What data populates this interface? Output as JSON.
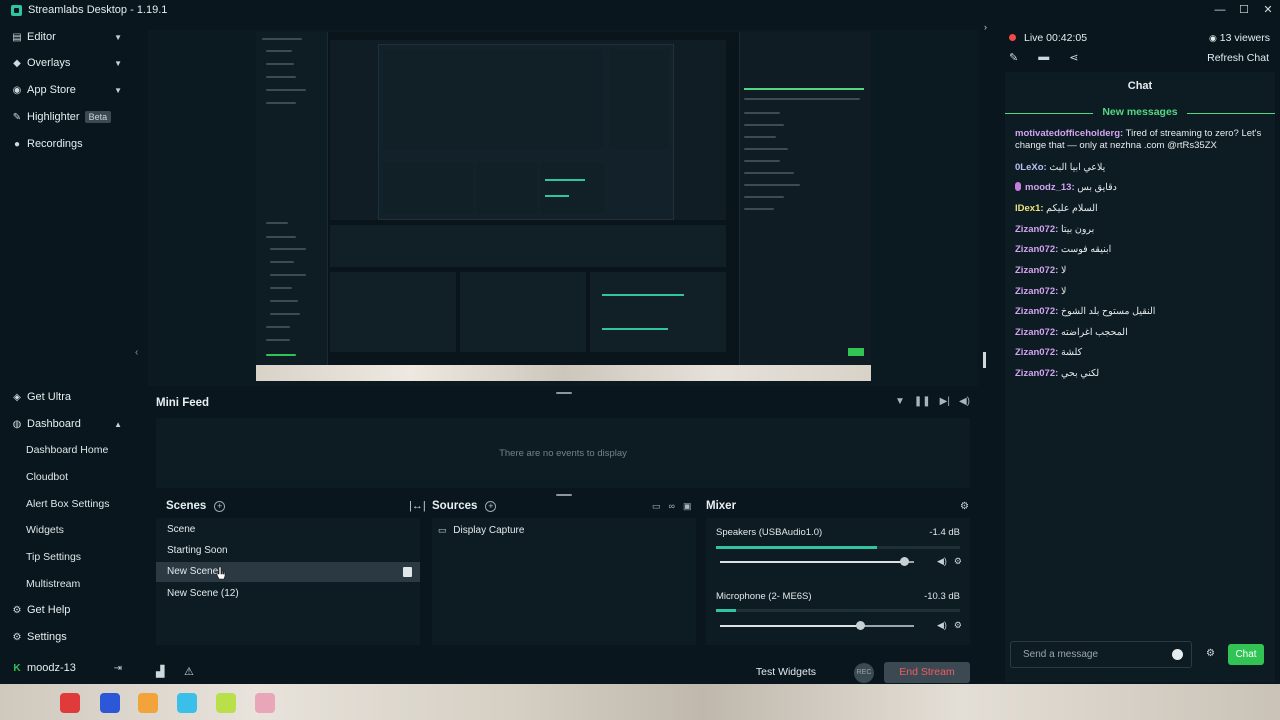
{
  "app": {
    "title": "Streamlabs Desktop - 1.19.1"
  },
  "window_controls": {
    "minimize": "—",
    "maximize": "☐",
    "close": "✕"
  },
  "sidebar": {
    "top_items": [
      {
        "label": "Editor",
        "icon": "editor-icon"
      },
      {
        "label": "Overlays",
        "icon": "overlays-icon"
      },
      {
        "label": "App Store",
        "icon": "appstore-icon"
      },
      {
        "label": "Highlighter",
        "icon": "highlighter-icon",
        "badge": "Beta"
      },
      {
        "label": "Recordings",
        "icon": "recordings-icon"
      }
    ],
    "get_ultra": "Get Ultra",
    "dashboard": "Dashboard",
    "dashboard_items": [
      "Dashboard Home",
      "Cloudbot",
      "Alert Box Settings",
      "Widgets",
      "Tip Settings",
      "Multistream"
    ],
    "get_help": "Get Help",
    "settings": "Settings",
    "user": "moodz-13"
  },
  "minifeed": {
    "title": "Mini Feed",
    "empty": "There are no events to display"
  },
  "scenes": {
    "title": "Scenes",
    "items": [
      "Scene",
      "Starting Soon",
      "New Scene",
      "New Scene (12)"
    ],
    "selected_index": 2
  },
  "sources": {
    "title": "Sources",
    "items": [
      "Display Capture"
    ]
  },
  "mixer": {
    "title": "Mixer",
    "channels": [
      {
        "name": "Speakers (USBAudio1.0)",
        "db": "-1.4 dB",
        "level": 0.66,
        "volume": 0.95
      },
      {
        "name": "Microphone (2- ME6S)",
        "db": "-10.3 dB",
        "level": 0.08,
        "volume": 0.72
      }
    ]
  },
  "footer": {
    "test_widgets": "Test Widgets",
    "rec": "REC",
    "end_stream": "End Stream"
  },
  "chat": {
    "live": "Live 00:42:05",
    "viewers": "13 viewers",
    "refresh": "Refresh Chat",
    "title": "Chat",
    "new_messages": "New messages",
    "messages": [
      {
        "user": "motivatedofficeholderg:",
        "text": "Tired of streaming to zero? Let's change that — only at nezhna .com @rtRs35ZX",
        "style": "p"
      },
      {
        "user": "0LeXo:",
        "text": "يلاعي ابيا البث",
        "style": "p"
      },
      {
        "user": "moodz_13:",
        "text": "دقايق بس",
        "style": "p",
        "badge": true
      },
      {
        "user": "lDex1:",
        "text": "السلام عليكم",
        "style": "y"
      },
      {
        "user": "Zizan072:",
        "text": "برون بيتا",
        "style": "p"
      },
      {
        "user": "Zizan072:",
        "text": "ابنيقه فوست",
        "style": "p"
      },
      {
        "user": "Zizan072:",
        "text": "لا",
        "style": "p"
      },
      {
        "user": "Zizan072:",
        "text": "لا",
        "style": "p"
      },
      {
        "user": "Zizan072:",
        "text": "النقيل مستوح بلد الشوخ",
        "style": "p"
      },
      {
        "user": "Zizan072:",
        "text": "المحجب اغراضته",
        "style": "p"
      },
      {
        "user": "Zizan072:",
        "text": "كلشة",
        "style": "p"
      },
      {
        "user": "Zizan072:",
        "text": "لكني بحي",
        "style": "p"
      }
    ],
    "input_placeholder": "Send a message",
    "send": "Chat"
  },
  "colors": {
    "accent": "#31c3a2",
    "live": "#f24a4a",
    "send": "#31c455",
    "end_stream_text": "#f25a63"
  }
}
